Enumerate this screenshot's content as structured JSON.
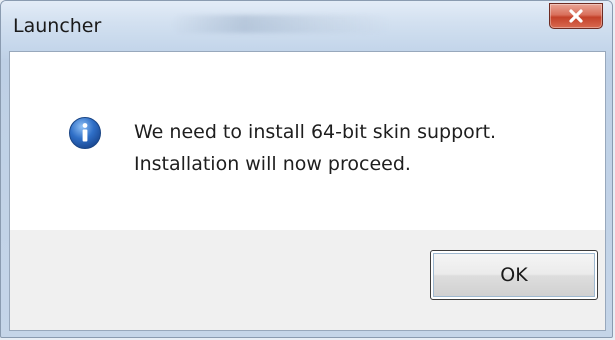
{
  "window": {
    "title": "Launcher",
    "close_icon": "close-icon"
  },
  "dialog": {
    "icon": "info-icon",
    "message_line1": "We need to install 64-bit skin support.",
    "message_line2": "Installation will now proceed.",
    "ok_label": "OK"
  },
  "colors": {
    "close_button": "#c4412a",
    "info_icon": "#2f6fc7",
    "content_bg": "#ffffff",
    "button_area_bg": "#f0f0f0"
  }
}
